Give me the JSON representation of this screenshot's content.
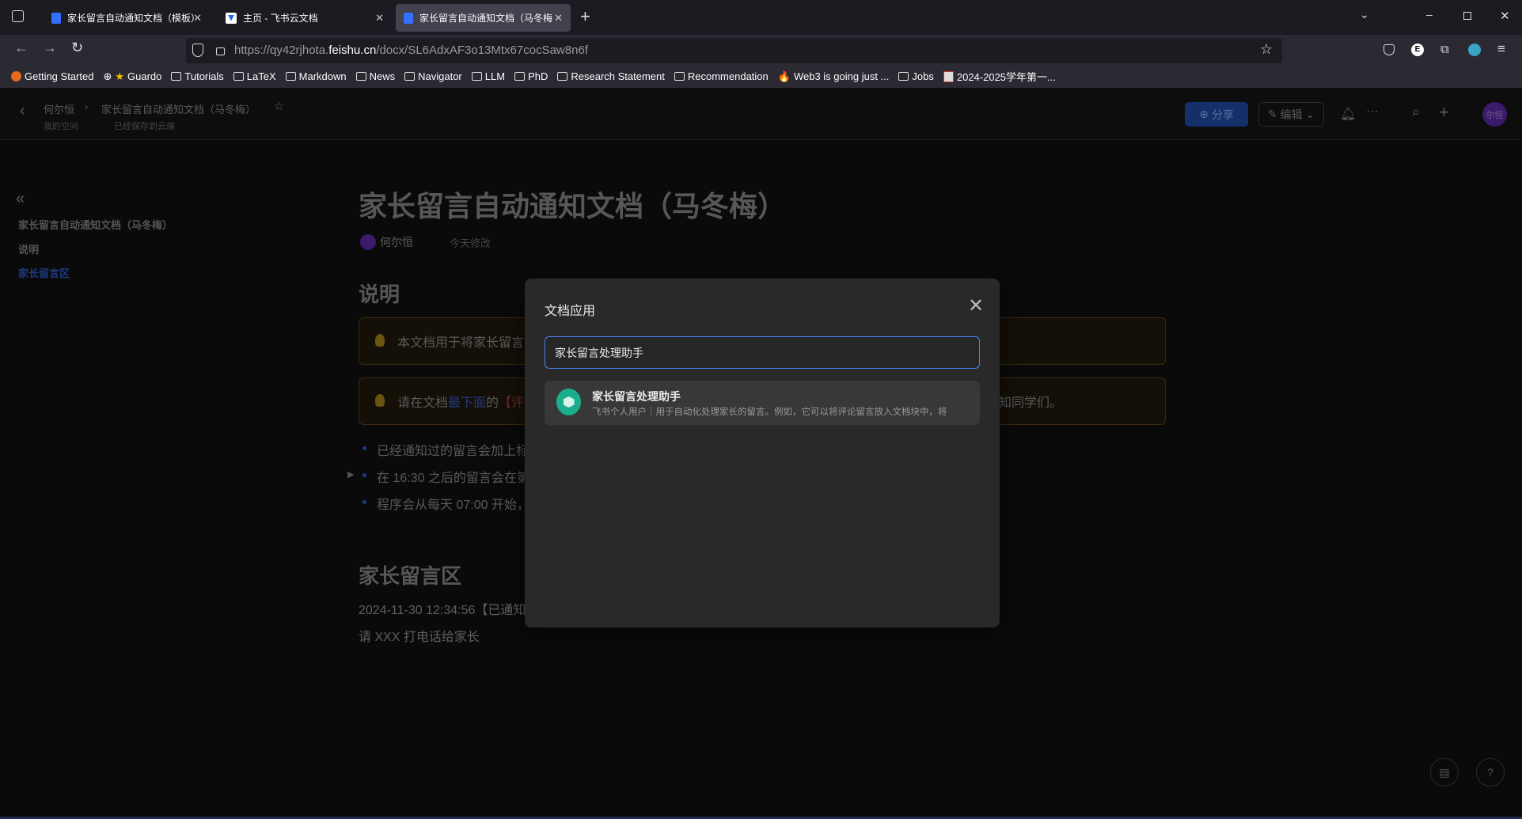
{
  "browser": {
    "tabs": [
      {
        "title": "家长留言自动通知文档（模板）",
        "active": false
      },
      {
        "title": "主页 - 飞书云文档",
        "active": false
      },
      {
        "title": "家长留言自动通知文档（马冬梅",
        "active": true
      }
    ],
    "url_prefix": "https://qy42rjhota.",
    "url_domain": "feishu.cn",
    "url_path": "/docx/SL6AdxAF3o13Mtx67cocSaw8n6f",
    "bookmarks": [
      "Getting Started",
      "Guardo",
      "Tutorials",
      "LaTeX",
      "Markdown",
      "News",
      "Navigator",
      "LLM",
      "PhD",
      "Research Statement",
      "Recommendation",
      "Web3 is going just ...",
      "Jobs",
      "2024-2025学年第一..."
    ]
  },
  "header": {
    "breadcrumb_owner": "何尔恒",
    "breadcrumb_doc": "家长留言自动通知文档（马冬梅）",
    "space": "我的空间",
    "save_status": "已经保存到云端",
    "share_label": "分享",
    "edit_label": "编辑",
    "avatar_text": "尔恒"
  },
  "outline": {
    "items": [
      {
        "label": "家长留言自动通知文档（马冬梅）"
      },
      {
        "label": "说明"
      },
      {
        "label": "家长留言区",
        "active": true
      }
    ]
  },
  "doc": {
    "title": "家长留言自动通知文档（马冬梅）",
    "author": "何尔恒",
    "modified": "今天修改",
    "section1": "说明",
    "callout1": "本文档用于将家长留言",
    "callout2_a": "请在文档",
    "callout2_link": "最下面",
    "callout2_b": "的",
    "callout2_red": "【评",
    "callout2_tail": "知同学们。",
    "bullets": [
      "已经通知过的留言会加上标",
      "在 16:30 之后的留言会在第",
      "程序会从每天 07:00 开始，"
    ],
    "section2": "家长留言区",
    "entry_line": "2024-11-30 12:34:56【已通知",
    "entry_body": "请 XXX 打电话给家长"
  },
  "modal": {
    "title": "文档应用",
    "search_value": "家长留言处理助手",
    "results": [
      {
        "name": "家长留言处理助手",
        "description": "飞书个人用户｜用于自动化处理家长的留言。例如，它可以将评论留言放入文档块中，将"
      }
    ]
  },
  "colors": {
    "accent": "#4c82f7",
    "share_bg": "#14306a",
    "app_icon": "#1aae8f"
  }
}
